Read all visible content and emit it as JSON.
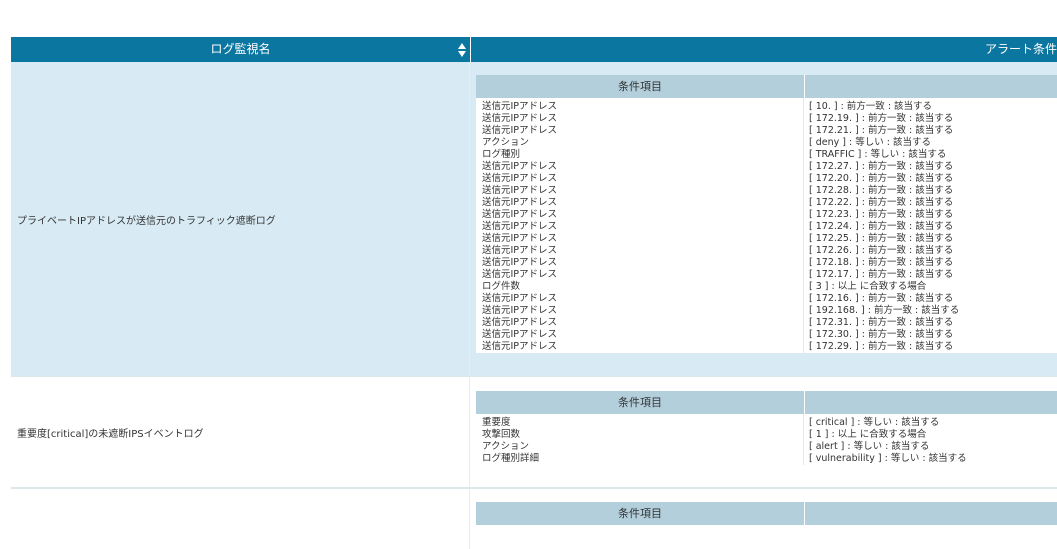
{
  "header": {
    "col_name": "ログ監視名",
    "col_condition": "アラート条件"
  },
  "inner_header_label": "条件項目",
  "rows": [
    {
      "name": "プライベートIPアドレスが送信元のトラフィック遮断ログ",
      "items": [
        {
          "k": "送信元IPアドレス",
          "v": "[ 10. ] : 前方一致 : 該当する"
        },
        {
          "k": "送信元IPアドレス",
          "v": "[ 172.19. ] : 前方一致 : 該当する"
        },
        {
          "k": "送信元IPアドレス",
          "v": "[ 172.21. ] : 前方一致 : 該当する"
        },
        {
          "k": "アクション",
          "v": "[ deny ] : 等しい : 該当する"
        },
        {
          "k": "ログ種別",
          "v": "[ TRAFFIC ] : 等しい : 該当する"
        },
        {
          "k": "送信元IPアドレス",
          "v": "[ 172.27. ] : 前方一致 : 該当する"
        },
        {
          "k": "送信元IPアドレス",
          "v": "[ 172.20. ] : 前方一致 : 該当する"
        },
        {
          "k": "送信元IPアドレス",
          "v": "[ 172.28. ] : 前方一致 : 該当する"
        },
        {
          "k": "送信元IPアドレス",
          "v": "[ 172.22. ] : 前方一致 : 該当する"
        },
        {
          "k": "送信元IPアドレス",
          "v": "[ 172.23. ] : 前方一致 : 該当する"
        },
        {
          "k": "送信元IPアドレス",
          "v": "[ 172.24. ] : 前方一致 : 該当する"
        },
        {
          "k": "送信元IPアドレス",
          "v": "[ 172.25. ] : 前方一致 : 該当する"
        },
        {
          "k": "送信元IPアドレス",
          "v": "[ 172.26. ] : 前方一致 : 該当する"
        },
        {
          "k": "送信元IPアドレス",
          "v": "[ 172.18. ] : 前方一致 : 該当する"
        },
        {
          "k": "送信元IPアドレス",
          "v": "[ 172.17. ] : 前方一致 : 該当する"
        },
        {
          "k": "ログ件数",
          "v": "[ 3 ] : 以上 に合致する場合"
        },
        {
          "k": "送信元IPアドレス",
          "v": "[ 172.16. ] : 前方一致 : 該当する"
        },
        {
          "k": "送信元IPアドレス",
          "v": "[ 192.168. ] : 前方一致 : 該当する"
        },
        {
          "k": "送信元IPアドレス",
          "v": "[ 172.31. ] : 前方一致 : 該当する"
        },
        {
          "k": "送信元IPアドレス",
          "v": "[ 172.30. ] : 前方一致 : 該当する"
        },
        {
          "k": "送信元IPアドレス",
          "v": "[ 172.29. ] : 前方一致 : 該当する"
        }
      ]
    },
    {
      "name": "重要度[critical]の未遮断IPSイベントログ",
      "items": [
        {
          "k": "重要度",
          "v": "[ critical ] : 等しい : 該当する"
        },
        {
          "k": "攻撃回数",
          "v": "[ 1 ] : 以上 に合致する場合"
        },
        {
          "k": "アクション",
          "v": "[ alert ] : 等しい : 該当する"
        },
        {
          "k": "ログ種別詳細",
          "v": "[ vulnerability ] : 等しい : 該当する"
        }
      ]
    },
    {
      "name": "",
      "items": []
    }
  ]
}
